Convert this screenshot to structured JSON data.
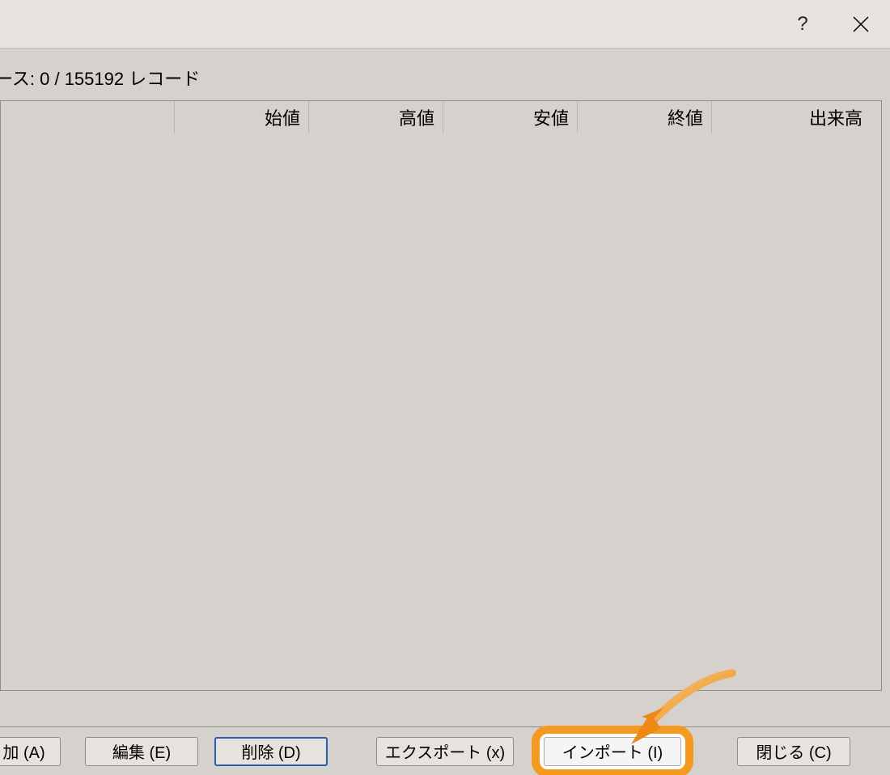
{
  "titlebar": {
    "help_symbol": "?",
    "close_label": "close"
  },
  "status_text": "ース: 0 / 155192 レコード",
  "columns": {
    "open": "始値",
    "high": "高値",
    "low": "安値",
    "close": "終値",
    "volume": "出来高"
  },
  "buttons": {
    "add": "加 (A)",
    "edit": "編集 (E)",
    "delete": "削除 (D)",
    "export": "エクスポート (x)",
    "import": "インポート (I)",
    "close": "閉じる (C)"
  }
}
